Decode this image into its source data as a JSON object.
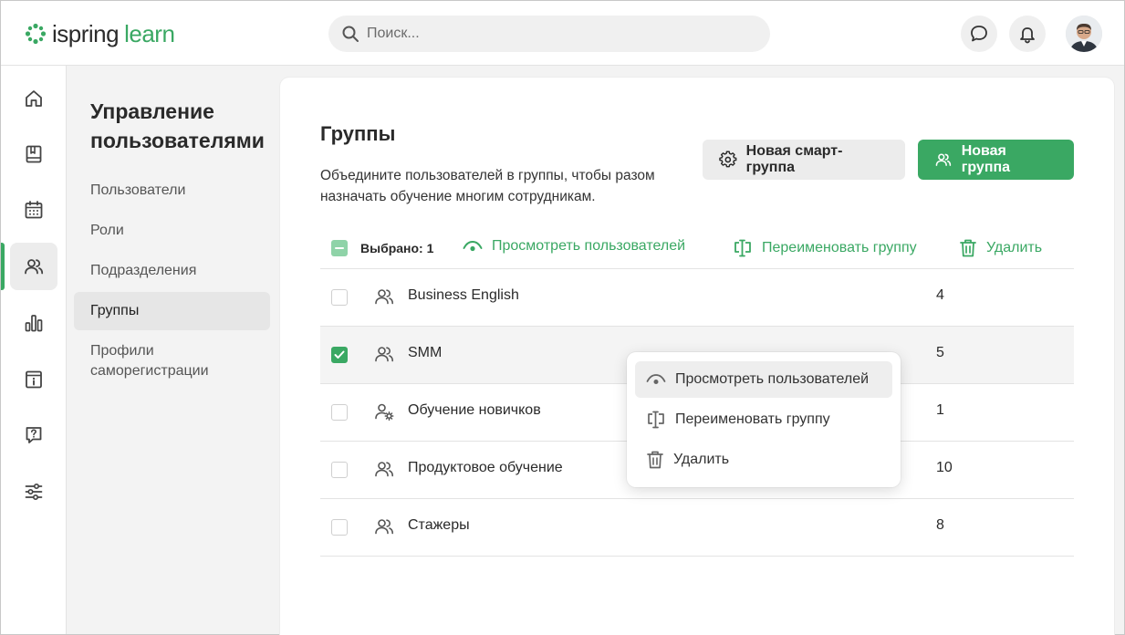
{
  "header": {
    "logo_part1": "ispring",
    "logo_part2": "learn",
    "search_placeholder": "Поиск..."
  },
  "subnav": {
    "title": "Управление пользователями",
    "items": [
      {
        "label": "Пользователи",
        "active": false
      },
      {
        "label": "Роли",
        "active": false
      },
      {
        "label": "Подразделения",
        "active": false
      },
      {
        "label": "Группы",
        "active": true
      },
      {
        "label": "Профили саморегистрации",
        "active": false
      }
    ]
  },
  "main": {
    "title": "Группы",
    "description": "Объедините пользователей в группы, чтобы разом назначать обучение многим сотрудникам.",
    "smart_group_button": "Новая смарт-группа",
    "new_group_button": "Новая группа"
  },
  "actionbar": {
    "selected_label": "Выбрано: 1",
    "view_users": "Просмотреть пользователей",
    "rename_group": "Переименовать группу",
    "delete": "Удалить"
  },
  "groups": [
    {
      "name": "Business English",
      "count": "4",
      "checked": false,
      "icon": "users-icon"
    },
    {
      "name": "SMM",
      "count": "5",
      "checked": true,
      "icon": "users-icon"
    },
    {
      "name": "Обучение новичков",
      "count": "1",
      "checked": false,
      "icon": "smart-group-icon"
    },
    {
      "name": "Продуктовое обучение",
      "count": "10",
      "checked": false,
      "icon": "users-icon"
    },
    {
      "name": "Стажеры",
      "count": "8",
      "checked": false,
      "icon": "users-icon"
    }
  ],
  "context_menu": {
    "view_users": "Просмотреть пользователей",
    "rename_group": "Переименовать группу",
    "delete": "Удалить"
  },
  "colors": {
    "accent": "#3aa863",
    "accent_light": "#8fd3a8"
  }
}
